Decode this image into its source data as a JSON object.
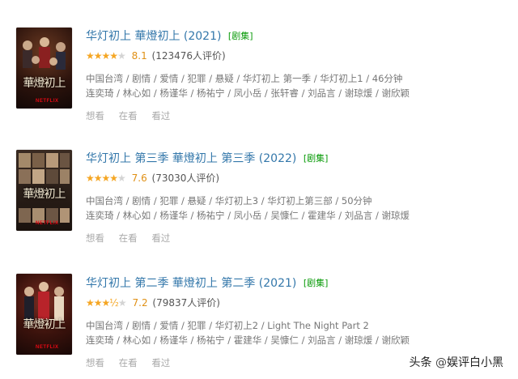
{
  "colors": {
    "link": "#3377aa",
    "badge": "#0a9b0a",
    "star": "#f5a623",
    "score": "#e09015"
  },
  "entries": [
    {
      "title": "华灯初上 華燈初上 (2021)",
      "badge": "[剧集]",
      "stars": "★★★★",
      "stars_off": "★",
      "score": "8.1",
      "count": "(123476人评价)",
      "meta": "中国台湾 / 剧情 / 爱情 / 犯罪 / 悬疑 / 华灯初上 第一季 / 华灯初上1 / 46分钟",
      "cast": "连奕琦 / 林心如 / 杨谨华 / 杨祐宁 / 凤小岳 / 张轩睿 / 刘品言 / 谢琼煖 / 谢欣颖",
      "actions": [
        "想看",
        "在看",
        "看过"
      ],
      "poster_title": "華燈初上"
    },
    {
      "title": "华灯初上 第三季 華燈初上 第三季 (2022)",
      "badge": "[剧集]",
      "stars": "★★★★",
      "stars_off": "★",
      "score": "7.6",
      "count": "(73030人评价)",
      "meta": "中国台湾 / 剧情 / 犯罪 / 悬疑 / 华灯初上3 / 华灯初上第三部 / 50分钟",
      "cast": "连奕琦 / 林心如 / 杨谨华 / 杨祐宁 / 凤小岳 / 吴慷仁 / 霍建华 / 刘品言 / 谢琼煖",
      "actions": [
        "想看",
        "在看",
        "看过"
      ],
      "poster_title": "華燈初上"
    },
    {
      "title": "华灯初上 第二季 華燈初上 第二季 (2021)",
      "badge": "[剧集]",
      "stars": "★★★½",
      "stars_off": "★",
      "score": "7.2",
      "count": "(79837人评价)",
      "meta": "中国台湾 / 剧情 / 爱情 / 犯罪 / 华灯初上2 / Light The Night Part 2",
      "cast": "连奕琦 / 林心如 / 杨谨华 / 杨祐宁 / 霍建华 / 吴慷仁 / 刘品言 / 谢琼煖 / 谢欣颖",
      "actions": [
        "想看",
        "在看",
        "看过"
      ],
      "poster_title": "華燈初上"
    }
  ],
  "watermark": {
    "prefix": "头条",
    "at": "@",
    "name": "娱评白小黑"
  }
}
